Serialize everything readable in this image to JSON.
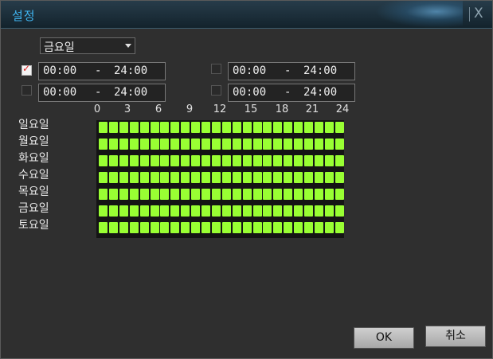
{
  "window": {
    "title": "설정",
    "close_glyph": "X"
  },
  "day_select": {
    "value": "금요일"
  },
  "periods": [
    {
      "checked": true,
      "start": "00:00",
      "sep": "-",
      "end": "24:00"
    },
    {
      "checked": false,
      "start": "00:00",
      "sep": "-",
      "end": "24:00"
    },
    {
      "checked": false,
      "start": "00:00",
      "sep": "-",
      "end": "24:00"
    },
    {
      "checked": false,
      "start": "00:00",
      "sep": "-",
      "end": "24:00"
    }
  ],
  "hour_labels": [
    "0",
    "3",
    "6",
    "9",
    "12",
    "15",
    "18",
    "21",
    "24"
  ],
  "days": [
    "일요일",
    "월요일",
    "화요일",
    "수요일",
    "목요일",
    "금요일",
    "토요일"
  ],
  "schedule": {
    "cells_per_day": 24,
    "all_active": true,
    "active_color": "#99ff33"
  },
  "buttons": {
    "ok": "OK",
    "cancel": "취소"
  }
}
